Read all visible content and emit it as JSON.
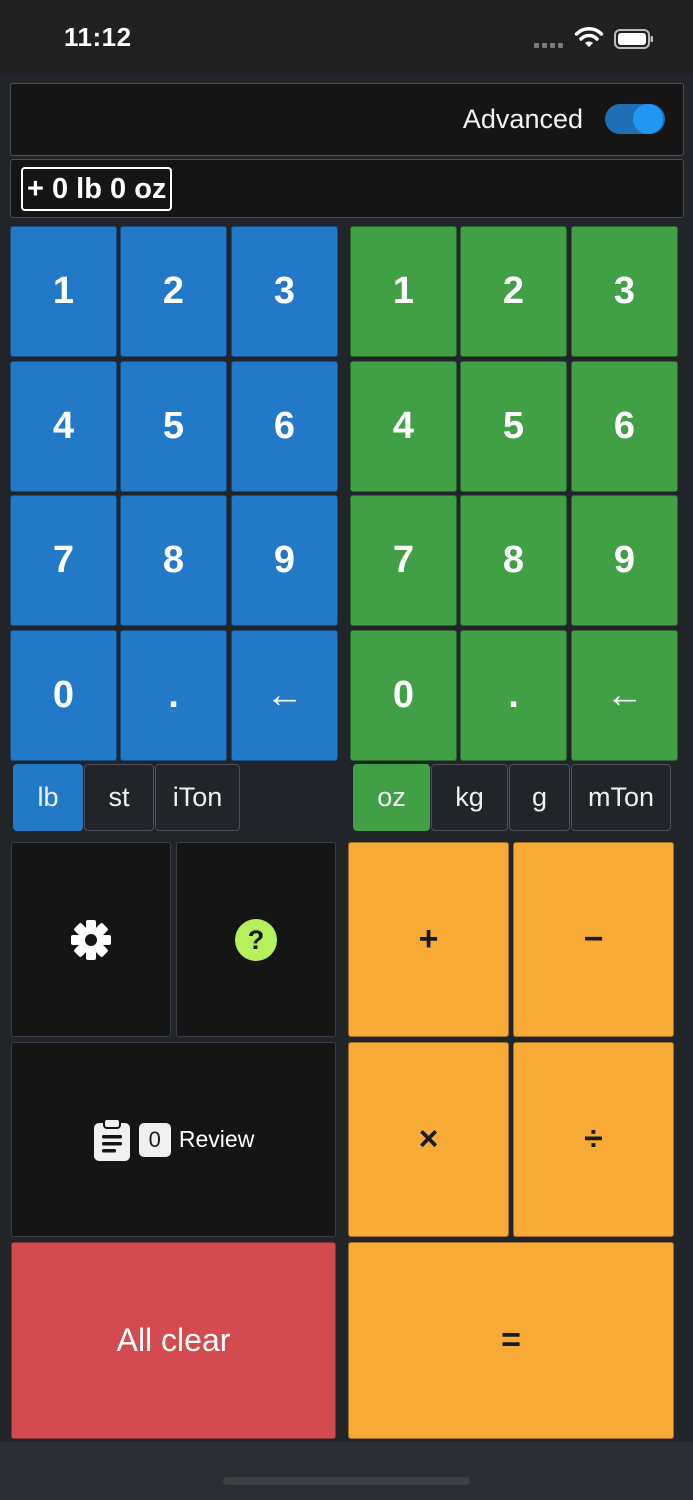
{
  "status_bar": {
    "time": "11:12",
    "icons": [
      "cellular-signal-icon",
      "wifi-icon",
      "battery-icon"
    ]
  },
  "header": {
    "advanced_label": "Advanced",
    "advanced_enabled": true
  },
  "display": {
    "value": "+ 0 lb 0 oz"
  },
  "left_keypad": {
    "keys": [
      "1",
      "2",
      "3",
      "4",
      "5",
      "6",
      "7",
      "8",
      "9",
      "0",
      ".",
      "←"
    ],
    "color": "#2179c8"
  },
  "right_keypad": {
    "keys": [
      "1",
      "2",
      "3",
      "4",
      "5",
      "6",
      "7",
      "8",
      "9",
      "0",
      ".",
      "←"
    ],
    "color": "#41a046"
  },
  "left_units": {
    "options": [
      "lb",
      "st",
      "iTon"
    ],
    "selected": "lb"
  },
  "right_units": {
    "options": [
      "oz",
      "kg",
      "g",
      "mTon"
    ],
    "selected": "oz"
  },
  "controls": {
    "settings_icon": "gear-icon",
    "help_icon": "question-circle-icon",
    "review_icon": "clipboard-icon",
    "review_count": "0",
    "review_label": "Review",
    "clear_label": "All clear"
  },
  "operators": {
    "add": "+",
    "subtract": "−",
    "multiply": "×",
    "divide": "÷",
    "equals": "="
  },
  "colors": {
    "orange": "#f8aa37",
    "red": "#d34b4f",
    "help_green": "#b4f15a"
  }
}
